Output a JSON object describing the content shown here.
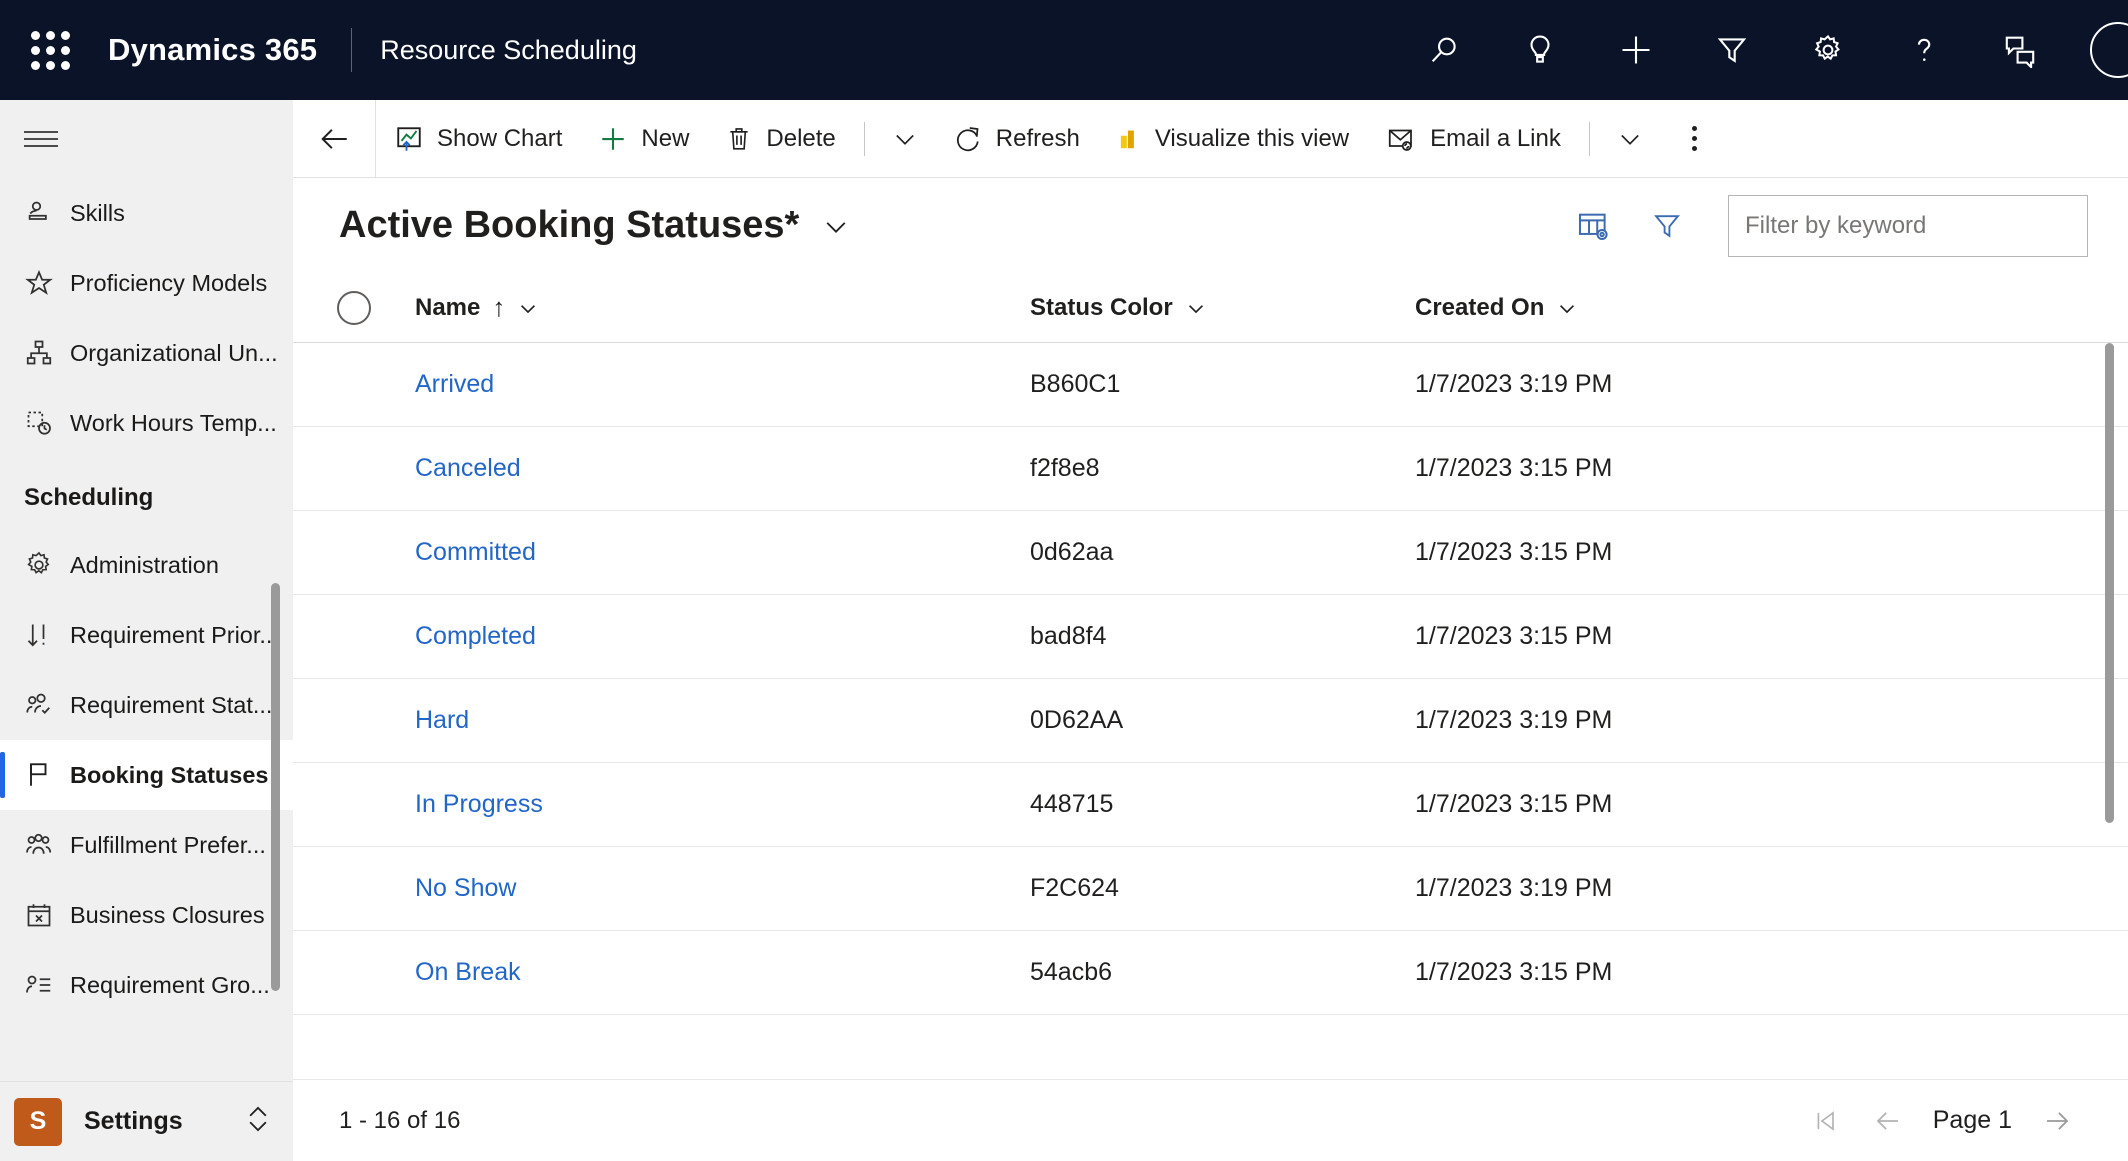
{
  "topnav": {
    "waffle_label": "app-launcher",
    "brand": "Dynamics 365",
    "app_name": "Resource Scheduling",
    "icons": [
      "search-icon",
      "lightbulb-icon",
      "plus-icon",
      "filter-icon",
      "gear-icon",
      "help-icon",
      "feedback-icon"
    ]
  },
  "sidebar": {
    "items": [
      {
        "label": "Skills",
        "icon": "skills-icon"
      },
      {
        "label": "Proficiency Models",
        "icon": "star-icon"
      },
      {
        "label": "Organizational Un...",
        "icon": "org-chart-icon"
      },
      {
        "label": "Work Hours Temp...",
        "icon": "work-hours-icon"
      }
    ],
    "group_header": "Scheduling",
    "group_items": [
      {
        "label": "Administration",
        "icon": "gear-icon",
        "selected": false
      },
      {
        "label": "Requirement Prior...",
        "icon": "sort-icon",
        "selected": false
      },
      {
        "label": "Requirement Stat...",
        "icon": "people-check-icon",
        "selected": false
      },
      {
        "label": "Booking Statuses",
        "icon": "flag-icon",
        "selected": true
      },
      {
        "label": "Fulfillment Prefer...",
        "icon": "people-icon",
        "selected": false
      },
      {
        "label": "Business Closures",
        "icon": "calendar-x-icon",
        "selected": false
      },
      {
        "label": "Requirement Gro...",
        "icon": "person-list-icon",
        "selected": false
      }
    ],
    "settings": {
      "badge": "S",
      "label": "Settings"
    }
  },
  "commandbar": {
    "back_label": "back-arrow",
    "buttons": [
      {
        "label": "Show Chart",
        "icon": "chart-icon"
      },
      {
        "label": "New",
        "icon": "plus-icon"
      },
      {
        "label": "Delete",
        "icon": "trash-icon"
      },
      {
        "label": "Refresh",
        "icon": "refresh-icon"
      },
      {
        "label": "Visualize this view",
        "icon": "bar-chart-icon"
      },
      {
        "label": "Email a Link",
        "icon": "email-link-icon"
      }
    ]
  },
  "view": {
    "title": "Active Booking Statuses*",
    "edit_columns_icon": "edit-columns-icon",
    "filter_icon": "filter-icon",
    "search_placeholder": "Filter by keyword"
  },
  "grid": {
    "columns": [
      {
        "label": "Name",
        "sort": "↑"
      },
      {
        "label": "Status Color",
        "sort": ""
      },
      {
        "label": "Created On",
        "sort": ""
      }
    ],
    "rows": [
      {
        "name": "Arrived",
        "status_color": "B860C1",
        "created_on": "1/7/2023 3:19 PM"
      },
      {
        "name": "Canceled",
        "status_color": "f2f8e8",
        "created_on": "1/7/2023 3:15 PM"
      },
      {
        "name": "Committed",
        "status_color": "0d62aa",
        "created_on": "1/7/2023 3:15 PM"
      },
      {
        "name": "Completed",
        "status_color": "bad8f4",
        "created_on": "1/7/2023 3:15 PM"
      },
      {
        "name": "Hard",
        "status_color": "0D62AA",
        "created_on": "1/7/2023 3:19 PM"
      },
      {
        "name": "In Progress",
        "status_color": "448715",
        "created_on": "1/7/2023 3:15 PM"
      },
      {
        "name": "No Show",
        "status_color": "F2C624",
        "created_on": "1/7/2023 3:19 PM"
      },
      {
        "name": "On Break",
        "status_color": "54acb6",
        "created_on": "1/7/2023 3:15 PM"
      }
    ]
  },
  "footer": {
    "count": "1 - 16 of 16",
    "page_label": "Page 1",
    "first_icon": "first-page-icon",
    "prev_icon": "previous-page-icon",
    "next_icon": "next-page-icon"
  },
  "colors": {
    "nav_bg": "#0b1328",
    "accent_link": "#2266c8",
    "selected_indicator": "#2266e3",
    "settings_badge": "#c05a1a",
    "sidebar_bg": "#f0f0f0"
  }
}
